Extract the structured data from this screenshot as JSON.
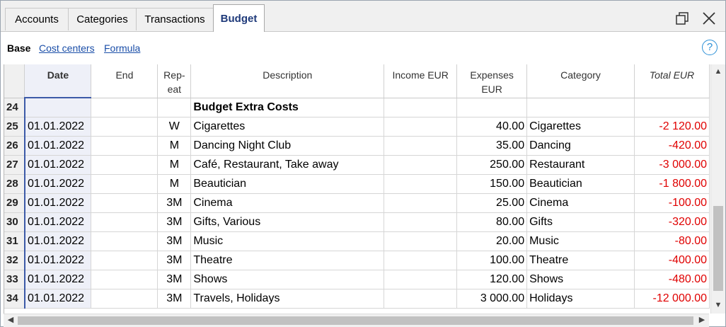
{
  "tabs": [
    {
      "label": "Accounts"
    },
    {
      "label": "Categories"
    },
    {
      "label": "Transactions"
    },
    {
      "label": "Budget",
      "active": true
    }
  ],
  "subtabs": {
    "base": "Base",
    "cost_centers": "Cost centers",
    "formula": "Formula"
  },
  "help_icon": "?",
  "columns": {
    "date": "Date",
    "end": "End",
    "repeat_1": "Rep-",
    "repeat_2": "eat",
    "description": "Description",
    "income": "Income EUR",
    "expenses": "Expenses EUR",
    "category": "Category",
    "total": "Total EUR"
  },
  "rows": [
    {
      "num": "24",
      "date": "",
      "end": "",
      "repeat": "",
      "description": "Budget Extra Costs",
      "income": "",
      "expenses": "",
      "category": "",
      "total": ""
    },
    {
      "num": "25",
      "date": "01.01.2022",
      "end": "",
      "repeat": "W",
      "description": "Cigarettes",
      "income": "",
      "expenses": "40.00",
      "category": "Cigarettes",
      "total": "-2 120.00"
    },
    {
      "num": "26",
      "date": "01.01.2022",
      "end": "",
      "repeat": "M",
      "description": "Dancing Night Club",
      "income": "",
      "expenses": "35.00",
      "category": "Dancing",
      "total": "-420.00"
    },
    {
      "num": "27",
      "date": "01.01.2022",
      "end": "",
      "repeat": "M",
      "description": "Café, Restaurant, Take away",
      "income": "",
      "expenses": "250.00",
      "category": "Restaurant",
      "total": "-3 000.00"
    },
    {
      "num": "28",
      "date": "01.01.2022",
      "end": "",
      "repeat": "M",
      "description": "Beautician",
      "income": "",
      "expenses": "150.00",
      "category": "Beautician",
      "total": "-1 800.00"
    },
    {
      "num": "29",
      "date": "01.01.2022",
      "end": "",
      "repeat": "3M",
      "description": "Cinema",
      "income": "",
      "expenses": "25.00",
      "category": "Cinema",
      "total": "-100.00"
    },
    {
      "num": "30",
      "date": "01.01.2022",
      "end": "",
      "repeat": "3M",
      "description": "Gifts, Various",
      "income": "",
      "expenses": "80.00",
      "category": "Gifts",
      "total": "-320.00"
    },
    {
      "num": "31",
      "date": "01.01.2022",
      "end": "",
      "repeat": "3M",
      "description": "Music",
      "income": "",
      "expenses": "20.00",
      "category": "Music",
      "total": "-80.00"
    },
    {
      "num": "32",
      "date": "01.01.2022",
      "end": "",
      "repeat": "3M",
      "description": "Theatre",
      "income": "",
      "expenses": "100.00",
      "category": "Theatre",
      "total": "-400.00"
    },
    {
      "num": "33",
      "date": "01.01.2022",
      "end": "",
      "repeat": "3M",
      "description": "Shows",
      "income": "",
      "expenses": "120.00",
      "category": "Shows",
      "total": "-480.00"
    },
    {
      "num": "34",
      "date": "01.01.2022",
      "end": "",
      "repeat": "3M",
      "description": "Travels, Holidays",
      "income": "",
      "expenses": "3 000.00",
      "category": "Holidays",
      "total": "-12 000.00"
    }
  ],
  "colors": {
    "negative": "#e00000",
    "accent": "#3c5aa8",
    "link": "#1a4ea8"
  },
  "icons": {
    "restore": "restore-window-icon",
    "close": "close-icon"
  }
}
